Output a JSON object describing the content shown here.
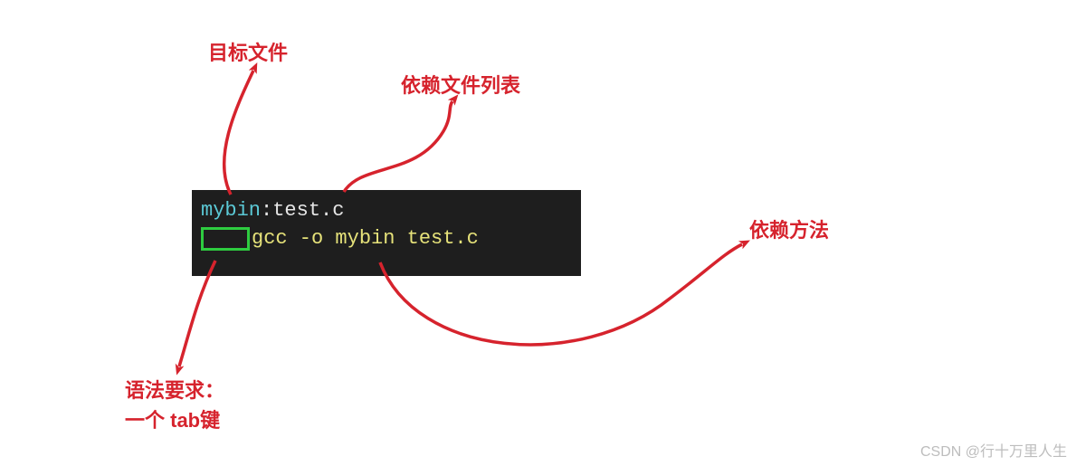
{
  "labels": {
    "target_file": "目标文件",
    "dep_file_list": "依赖文件列表",
    "dep_method": "依赖方法",
    "syntax_req_line1": "语法要求：",
    "syntax_req_line2": "一个 tab键"
  },
  "code": {
    "target": "mybin",
    "colon": ":",
    "dep": "test.c",
    "command": "gcc -o mybin test.c"
  },
  "watermark": "CSDN @行十万里人生",
  "colors": {
    "annotation": "#d6232d",
    "code_bg": "#1e1e1e",
    "tok_cyan": "#5bc9d6",
    "tok_white": "#e6e6e6",
    "tok_yellow": "#e6e27a",
    "tab_border": "#2ecc40"
  }
}
